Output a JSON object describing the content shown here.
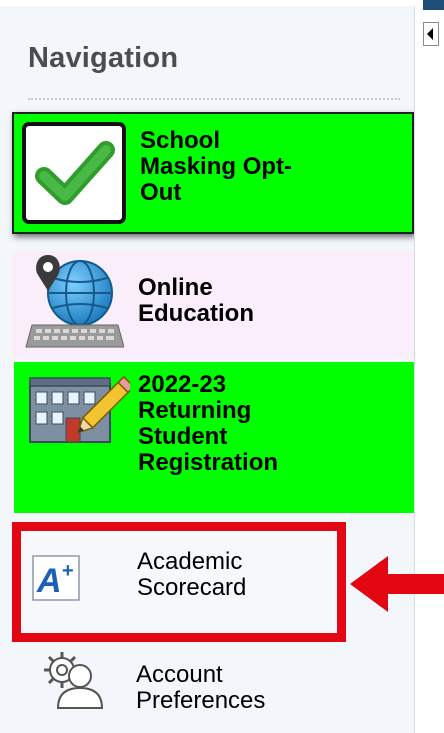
{
  "sidebar": {
    "title": "Navigation",
    "items": [
      {
        "label": "School\nMasking Opt-\nOut",
        "icon": "checkmark-icon",
        "highlight": "#00ff00"
      },
      {
        "label": "Online\nEducation",
        "icon": "globe-keyboard-icon",
        "highlight": "#fbeefb"
      },
      {
        "label": "2022-23\nReturning\nStudent\nRegistration",
        "icon": "school-building-pencil-icon",
        "highlight": "#00ff00"
      },
      {
        "label": "Academic\nScorecard",
        "icon": "a-plus-grade-icon",
        "outline": "#e30613"
      },
      {
        "label": "Account\nPreferences",
        "icon": "user-settings-icon"
      }
    ]
  },
  "annotation": {
    "arrow_color": "#e30613",
    "arrow_icon": "red-arrow-left-icon"
  },
  "collapse_toggle": {
    "icon": "collapse-left-icon"
  }
}
